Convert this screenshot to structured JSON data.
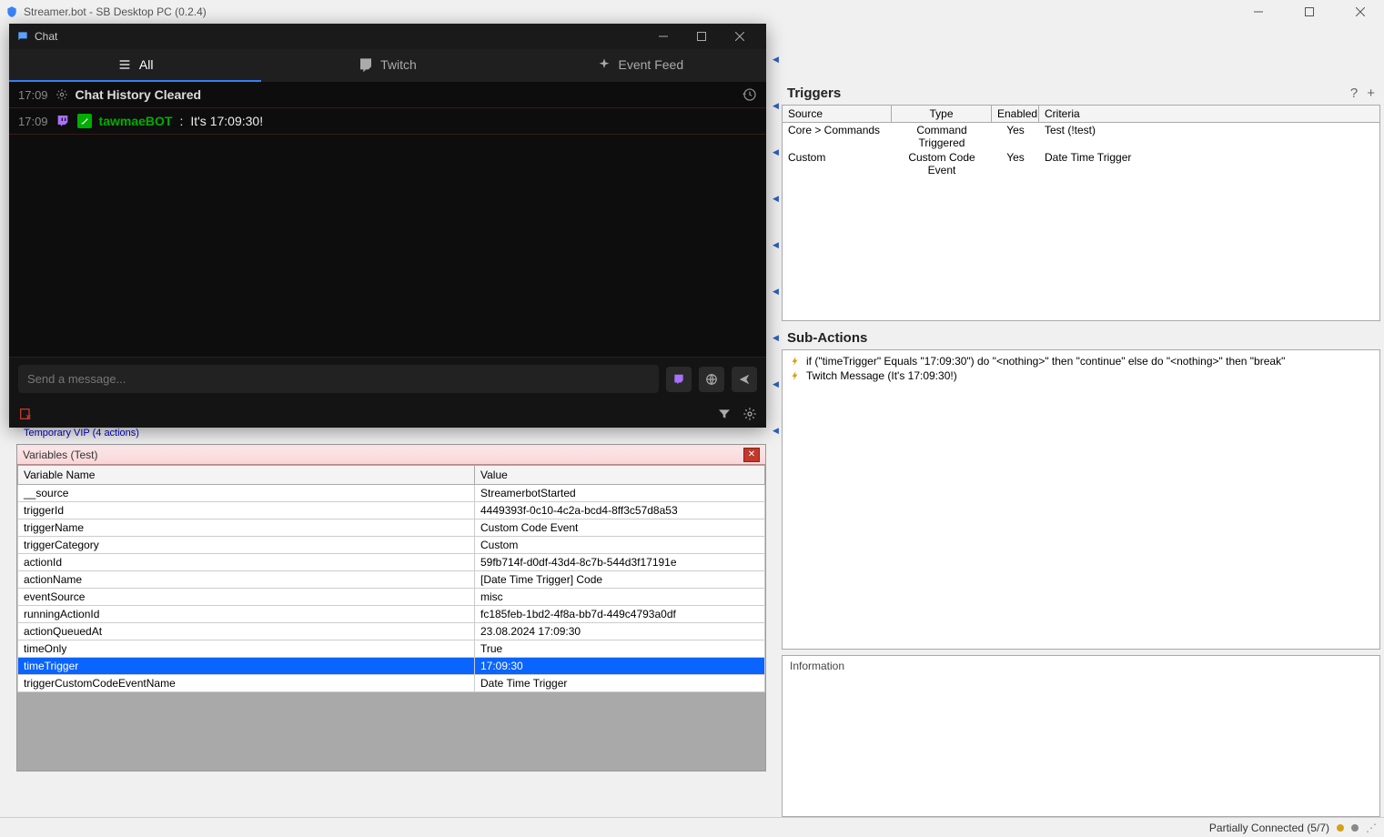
{
  "window": {
    "title": "Streamer.bot - SB Desktop PC (0.2.4)"
  },
  "chat": {
    "title": "Chat",
    "tabs": {
      "all": "All",
      "twitch": "Twitch",
      "eventfeed": "Event Feed"
    },
    "lines": {
      "l0_time": "17:09",
      "l0_text": "Chat History Cleared",
      "l1_time": "17:09",
      "l1_user": "tawmaeBOT",
      "l1_sep": ": ",
      "l1_msg": "It's 17:09:30!"
    },
    "input_placeholder": "Send a message..."
  },
  "peek": "Temporary VIP (4 actions)",
  "variables": {
    "title": "Variables (Test)",
    "headers": {
      "name": "Variable Name",
      "value": "Value"
    },
    "rows": [
      {
        "name": "__source",
        "value": "StreamerbotStarted"
      },
      {
        "name": "triggerId",
        "value": "4449393f-0c10-4c2a-bcd4-8ff3c57d8a53"
      },
      {
        "name": "triggerName",
        "value": "Custom Code Event"
      },
      {
        "name": "triggerCategory",
        "value": "Custom"
      },
      {
        "name": "actionId",
        "value": "59fb714f-d0df-43d4-8c7b-544d3f17191e"
      },
      {
        "name": "actionName",
        "value": "[Date Time Trigger] Code"
      },
      {
        "name": "eventSource",
        "value": "misc"
      },
      {
        "name": "runningActionId",
        "value": "fc185feb-1bd2-4f8a-bb7d-449c4793a0df"
      },
      {
        "name": "actionQueuedAt",
        "value": "23.08.2024 17:09:30"
      },
      {
        "name": "timeOnly",
        "value": "True"
      },
      {
        "name": "timeTrigger",
        "value": "17:09:30"
      },
      {
        "name": "triggerCustomCodeEventName",
        "value": "Date Time Trigger"
      }
    ],
    "selected_index": 10
  },
  "triggers": {
    "title": "Triggers",
    "headers": {
      "source": "Source",
      "type": "Type",
      "enabled": "Enabled",
      "criteria": "Criteria"
    },
    "rows": [
      {
        "source": "Core > Commands",
        "type": "Command Triggered",
        "enabled": "Yes",
        "criteria": "Test (!test)"
      },
      {
        "source": "Custom",
        "type": "Custom Code Event",
        "enabled": "Yes",
        "criteria": "Date Time Trigger"
      }
    ]
  },
  "subactions": {
    "title": "Sub-Actions",
    "items": [
      "if (\"timeTrigger\" Equals \"17:09:30\") do \"<nothing>\" then \"continue\" else do \"<nothing>\" then \"break\"",
      "Twitch Message (It's 17:09:30!)"
    ]
  },
  "info": {
    "title": "Information"
  },
  "footer": {
    "status": "Partially Connected (5/7)"
  }
}
